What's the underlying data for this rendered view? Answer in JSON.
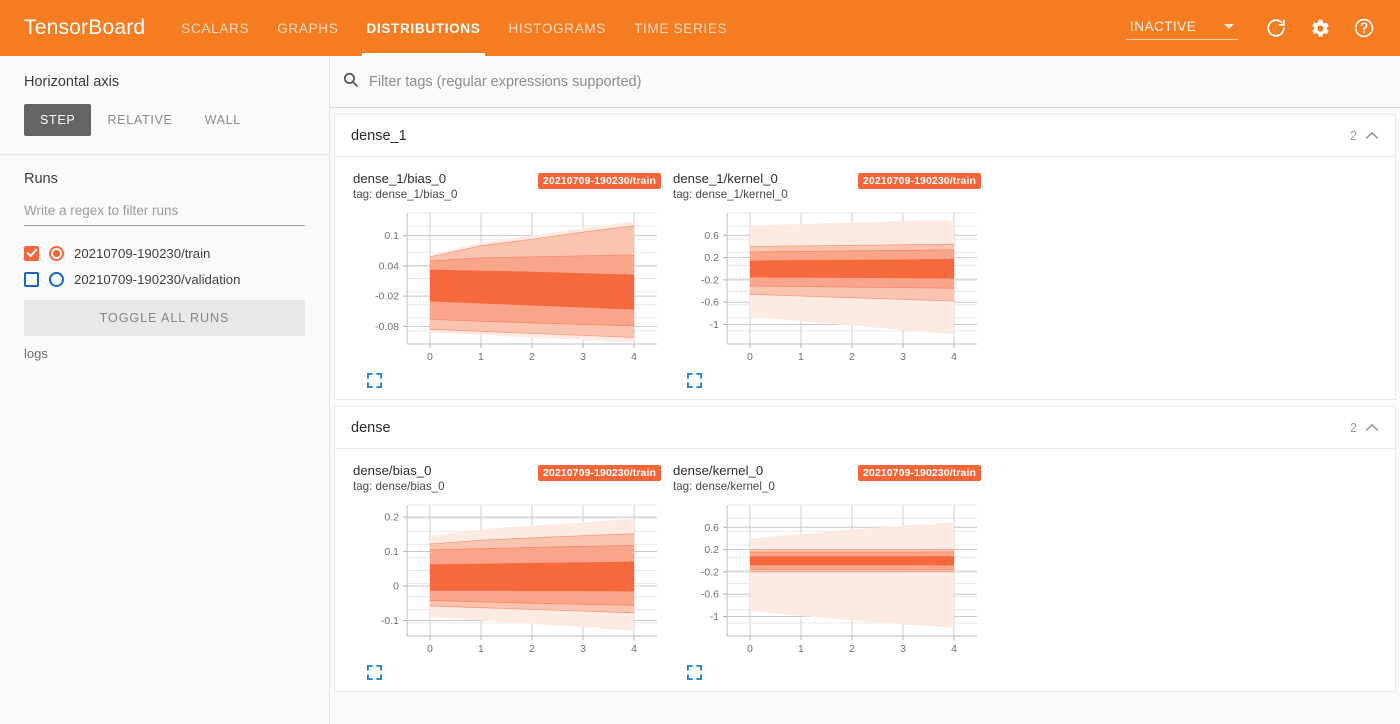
{
  "header": {
    "brand": "TensorBoard",
    "tabs": [
      {
        "label": "SCALARS",
        "active": false
      },
      {
        "label": "GRAPHS",
        "active": false
      },
      {
        "label": "DISTRIBUTIONS",
        "active": true
      },
      {
        "label": "HISTOGRAMS",
        "active": false
      },
      {
        "label": "TIME SERIES",
        "active": false
      }
    ],
    "status_label": "INACTIVE",
    "reload_icon": "refresh-icon",
    "settings_icon": "gear-icon",
    "help_icon": "help-circle-icon",
    "accent_color": "#f57c20"
  },
  "sidebar": {
    "horizontal_axis_title": "Horizontal axis",
    "axis_options": [
      {
        "label": "STEP",
        "active": true
      },
      {
        "label": "RELATIVE",
        "active": false
      },
      {
        "label": "WALL",
        "active": false
      }
    ],
    "runs_title": "Runs",
    "regex_placeholder": "Write a regex to filter runs",
    "regex_value": "",
    "runs": [
      {
        "label": "20210709-190230/train",
        "checked": true,
        "color": "#f4663a"
      },
      {
        "label": "20210709-190230/validation",
        "checked": false,
        "color": "#1665c0"
      }
    ],
    "toggle_all_label": "TOGGLE ALL RUNS",
    "logs_label": "logs"
  },
  "search": {
    "placeholder": "Filter tags (regular expressions supported)",
    "value": "",
    "icon": "search-icon"
  },
  "cards": [
    {
      "title": "dense_1",
      "count": "2",
      "charts": [
        {
          "name": "dense_1/bias_0",
          "tag": "tag: dense_1/bias_0",
          "badge": "20210709-190230/train"
        },
        {
          "name": "dense_1/kernel_0",
          "tag": "tag: dense_1/kernel_0",
          "badge": "20210709-190230/train"
        }
      ]
    },
    {
      "title": "dense",
      "count": "2",
      "charts": [
        {
          "name": "dense/bias_0",
          "tag": "tag: dense/bias_0",
          "badge": "20210709-190230/train"
        },
        {
          "name": "dense/kernel_0",
          "tag": "tag: dense/kernel_0",
          "badge": "20210709-190230/train"
        }
      ]
    }
  ],
  "chart_data": [
    {
      "type": "area",
      "id": "dense_1/bias_0",
      "title": "dense_1/bias_0",
      "xlabel": "",
      "ylabel": "",
      "x": [
        0,
        1,
        2,
        3,
        4
      ],
      "xticks": [
        0,
        1,
        2,
        3,
        4
      ],
      "yticks": [
        0.1,
        0.04,
        -0.02,
        -0.08
      ],
      "ylim": [
        -0.115,
        0.145
      ],
      "xlim": [
        -0.45,
        4.45
      ],
      "grid": true,
      "legend": "20210709-190230/train",
      "series": [
        {
          "name": "max",
          "values": [
            0.062,
            0.086,
            0.1,
            0.115,
            0.128
          ]
        },
        {
          "name": "p93",
          "values": [
            0.058,
            0.08,
            0.093,
            0.107,
            0.12
          ]
        },
        {
          "name": "p84",
          "values": [
            0.05,
            0.056,
            0.058,
            0.06,
            0.062
          ]
        },
        {
          "name": "p69",
          "values": [
            0.032,
            0.03,
            0.028,
            0.025,
            0.022
          ]
        },
        {
          "name": "median",
          "values": [
            -0.004,
            -0.006,
            -0.008,
            -0.01,
            -0.012
          ]
        },
        {
          "name": "p31",
          "values": [
            -0.03,
            -0.034,
            -0.038,
            -0.042,
            -0.046
          ]
        },
        {
          "name": "p16",
          "values": [
            -0.066,
            -0.07,
            -0.073,
            -0.076,
            -0.079
          ]
        },
        {
          "name": "p7",
          "values": [
            -0.086,
            -0.09,
            -0.094,
            -0.098,
            -0.102
          ]
        },
        {
          "name": "min",
          "values": [
            -0.092,
            -0.097,
            -0.102,
            -0.107,
            -0.112
          ]
        }
      ]
    },
    {
      "type": "area",
      "id": "dense_1/kernel_0",
      "title": "dense_1/kernel_0",
      "xlabel": "",
      "ylabel": "",
      "x": [
        0,
        1,
        2,
        3,
        4
      ],
      "xticks": [
        0,
        1,
        2,
        3,
        4
      ],
      "yticks": [
        0.6,
        0.2,
        -0.2,
        -0.6,
        -1
      ],
      "ylim": [
        -1.35,
        1.0
      ],
      "xlim": [
        -0.45,
        4.45
      ],
      "grid": true,
      "legend": "20210709-190230/train",
      "series": [
        {
          "name": "max",
          "values": [
            0.78,
            0.8,
            0.83,
            0.86,
            0.88
          ]
        },
        {
          "name": "p93",
          "values": [
            0.4,
            0.41,
            0.42,
            0.43,
            0.44
          ]
        },
        {
          "name": "p84",
          "values": [
            0.3,
            0.31,
            0.32,
            0.33,
            0.34
          ]
        },
        {
          "name": "p69",
          "values": [
            0.14,
            0.15,
            0.155,
            0.16,
            0.17
          ]
        },
        {
          "name": "median",
          "values": [
            0.0,
            0.0,
            0.0,
            0.0,
            0.0
          ]
        },
        {
          "name": "p31",
          "values": [
            -0.15,
            -0.155,
            -0.16,
            -0.165,
            -0.17
          ]
        },
        {
          "name": "p16",
          "values": [
            -0.31,
            -0.32,
            -0.33,
            -0.34,
            -0.35
          ]
        },
        {
          "name": "p7",
          "values": [
            -0.46,
            -0.49,
            -0.52,
            -0.55,
            -0.58
          ]
        },
        {
          "name": "min",
          "values": [
            -0.86,
            -0.94,
            -1.02,
            -1.1,
            -1.18
          ]
        }
      ]
    },
    {
      "type": "area",
      "id": "dense/bias_0",
      "title": "dense/bias_0",
      "xlabel": "",
      "ylabel": "",
      "x": [
        0,
        1,
        2,
        3,
        4
      ],
      "xticks": [
        0,
        1,
        2,
        3,
        4
      ],
      "yticks": [
        0.2,
        0.1,
        0,
        -0.1
      ],
      "ylim": [
        -0.145,
        0.235
      ],
      "xlim": [
        -0.45,
        4.45
      ],
      "grid": true,
      "legend": "20210709-190230/train",
      "series": [
        {
          "name": "max",
          "values": [
            0.145,
            0.165,
            0.175,
            0.185,
            0.195
          ]
        },
        {
          "name": "p93",
          "values": [
            0.122,
            0.133,
            0.14,
            0.146,
            0.152
          ]
        },
        {
          "name": "p84",
          "values": [
            0.105,
            0.108,
            0.112,
            0.115,
            0.118
          ]
        },
        {
          "name": "p69",
          "values": [
            0.062,
            0.064,
            0.066,
            0.068,
            0.07
          ]
        },
        {
          "name": "median",
          "values": [
            0.022,
            0.023,
            0.024,
            0.025,
            0.026
          ]
        },
        {
          "name": "p31",
          "values": [
            -0.013,
            -0.013,
            -0.014,
            -0.014,
            -0.015
          ]
        },
        {
          "name": "p16",
          "values": [
            -0.042,
            -0.046,
            -0.05,
            -0.053,
            -0.056
          ]
        },
        {
          "name": "p7",
          "values": [
            -0.058,
            -0.063,
            -0.068,
            -0.073,
            -0.078
          ]
        },
        {
          "name": "min",
          "values": [
            -0.09,
            -0.1,
            -0.11,
            -0.12,
            -0.13
          ]
        }
      ]
    },
    {
      "type": "area",
      "id": "dense/kernel_0",
      "title": "dense/kernel_0",
      "xlabel": "",
      "ylabel": "",
      "x": [
        0,
        1,
        2,
        3,
        4
      ],
      "xticks": [
        0,
        1,
        2,
        3,
        4
      ],
      "yticks": [
        0.6,
        0.2,
        -0.2,
        -0.6,
        -1
      ],
      "ylim": [
        -1.35,
        1.0
      ],
      "xlim": [
        -0.45,
        4.45
      ],
      "grid": true,
      "legend": "20210709-190230/train",
      "series": [
        {
          "name": "max",
          "values": [
            0.4,
            0.48,
            0.56,
            0.63,
            0.69
          ]
        },
        {
          "name": "p93",
          "values": [
            0.2,
            0.2,
            0.2,
            0.2,
            0.2
          ]
        },
        {
          "name": "p84",
          "values": [
            0.155,
            0.155,
            0.155,
            0.155,
            0.16
          ]
        },
        {
          "name": "p69",
          "values": [
            0.075,
            0.075,
            0.075,
            0.075,
            0.078
          ]
        },
        {
          "name": "median",
          "values": [
            0.0,
            0.0,
            0.0,
            0.0,
            0.0
          ]
        },
        {
          "name": "p31",
          "values": [
            -0.075,
            -0.075,
            -0.075,
            -0.075,
            -0.078
          ]
        },
        {
          "name": "p16",
          "values": [
            -0.155,
            -0.155,
            -0.155,
            -0.155,
            -0.16
          ]
        },
        {
          "name": "p7",
          "values": [
            -0.2,
            -0.2,
            -0.2,
            -0.2,
            -0.2
          ]
        },
        {
          "name": "min",
          "values": [
            -0.9,
            -0.99,
            -1.07,
            -1.14,
            -1.21
          ]
        }
      ]
    }
  ]
}
